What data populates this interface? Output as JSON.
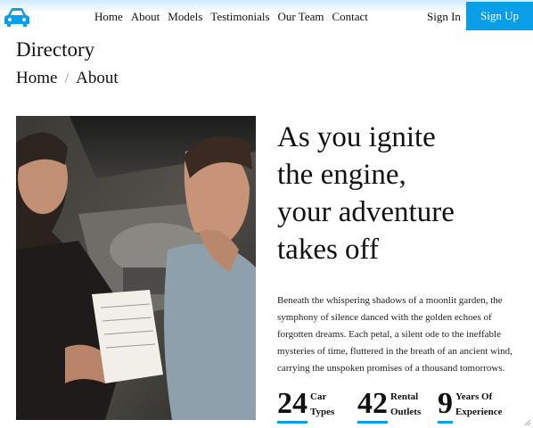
{
  "brand": {
    "logo_icon": "car-icon",
    "accent": "#0a9ee8"
  },
  "nav": {
    "items": [
      {
        "label": "Home"
      },
      {
        "label": "About"
      },
      {
        "label": "Models"
      },
      {
        "label": "Testimonials"
      },
      {
        "label": "Our Team"
      },
      {
        "label": "Contact"
      }
    ],
    "signin_label": "Sign In",
    "signup_label": "Sign Up"
  },
  "page": {
    "title": "Directory",
    "breadcrumb": {
      "home": "Home",
      "separator": "/",
      "current": "About"
    }
  },
  "hero": {
    "image_icon": "mechanic-photo",
    "headline_lines": [
      "As you ignite",
      "the engine,",
      "your adventure",
      "takes off"
    ],
    "body": "Beneath the whispering shadows of a moonlit garden, the symphony of silence danced with the golden echoes of forgotten dreams. Each petal, a silent ode to the ineffable mysteries of time, fluttered in the breath of an ancient wind, carrying the unspoken promises of a thousand tomorrows."
  },
  "stats": [
    {
      "value": "24",
      "label_1": "Car",
      "label_2": "Types"
    },
    {
      "value": "42",
      "label_1": "Rental",
      "label_2": "Outlets"
    },
    {
      "value": "9",
      "label_1": "Years Of",
      "label_2": "Experience"
    }
  ]
}
